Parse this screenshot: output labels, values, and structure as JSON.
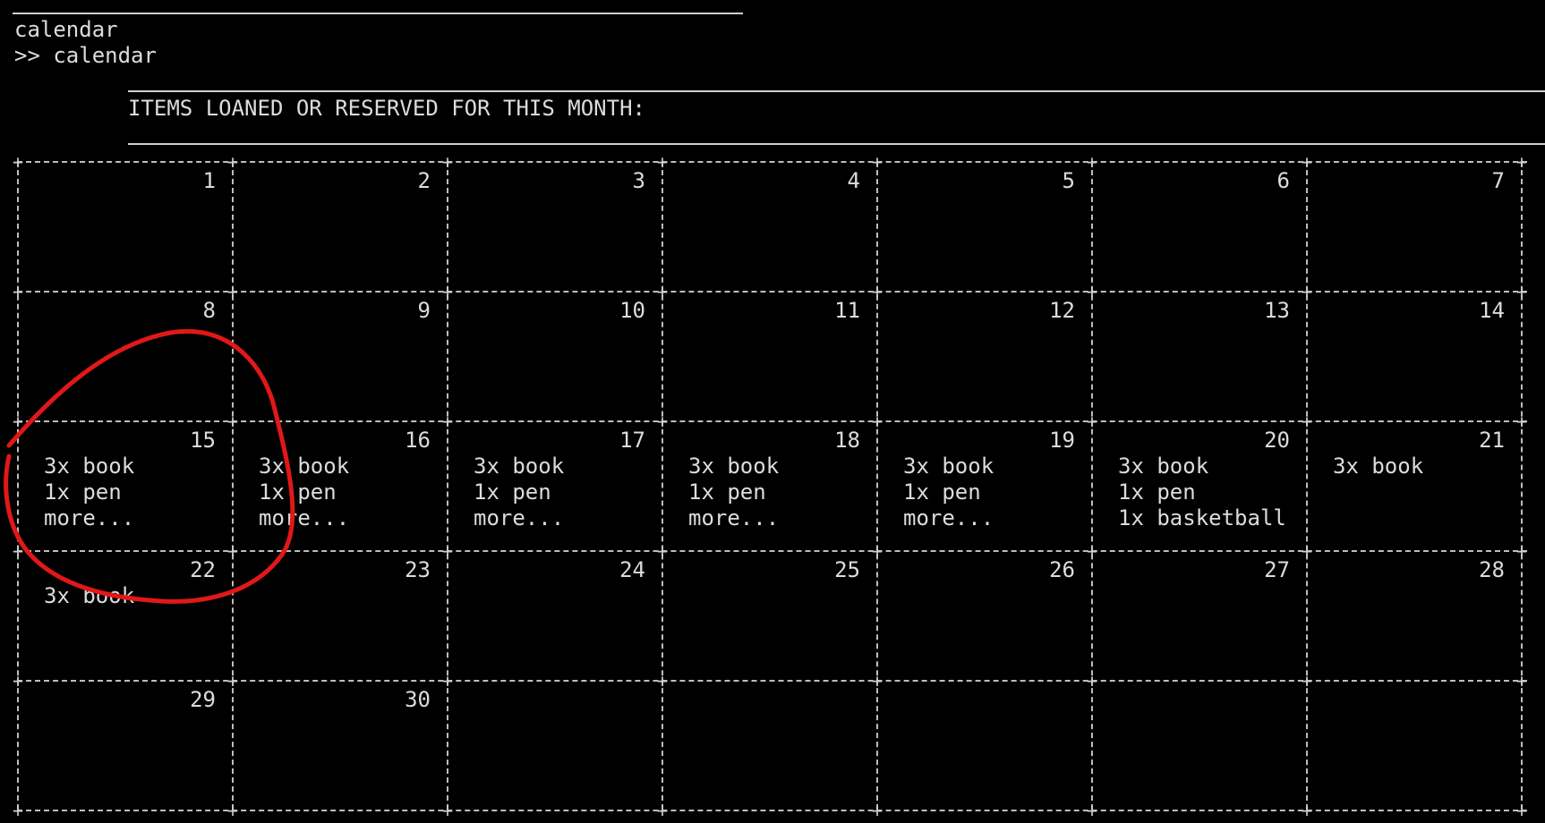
{
  "terminal": {
    "command_output": "calendar",
    "prompt": ">> calendar"
  },
  "header": {
    "title": "ITEMS LOANED OR RESERVED FOR THIS MONTH:"
  },
  "calendar": {
    "weeks": [
      [
        {
          "day": "1",
          "items": []
        },
        {
          "day": "2",
          "items": []
        },
        {
          "day": "3",
          "items": []
        },
        {
          "day": "4",
          "items": []
        },
        {
          "day": "5",
          "items": []
        },
        {
          "day": "6",
          "items": []
        },
        {
          "day": "7",
          "items": []
        }
      ],
      [
        {
          "day": "8",
          "items": []
        },
        {
          "day": "9",
          "items": []
        },
        {
          "day": "10",
          "items": []
        },
        {
          "day": "11",
          "items": []
        },
        {
          "day": "12",
          "items": []
        },
        {
          "day": "13",
          "items": []
        },
        {
          "day": "14",
          "items": []
        }
      ],
      [
        {
          "day": "15",
          "items": [
            "3x book",
            "1x pen",
            "more..."
          ]
        },
        {
          "day": "16",
          "items": [
            "3x book",
            "1x pen",
            "more..."
          ]
        },
        {
          "day": "17",
          "items": [
            "3x book",
            "1x pen",
            "more..."
          ]
        },
        {
          "day": "18",
          "items": [
            "3x book",
            "1x pen",
            "more..."
          ]
        },
        {
          "day": "19",
          "items": [
            "3x book",
            "1x pen",
            "more..."
          ]
        },
        {
          "day": "20",
          "items": [
            "3x book",
            "1x pen",
            "1x basketball"
          ]
        },
        {
          "day": "21",
          "items": [
            "3x book"
          ]
        }
      ],
      [
        {
          "day": "22",
          "items": [
            "3x book"
          ]
        },
        {
          "day": "23",
          "items": []
        },
        {
          "day": "24",
          "items": []
        },
        {
          "day": "25",
          "items": []
        },
        {
          "day": "26",
          "items": []
        },
        {
          "day": "27",
          "items": []
        },
        {
          "day": "28",
          "items": []
        }
      ],
      [
        {
          "day": "29",
          "items": []
        },
        {
          "day": "30",
          "items": []
        },
        {
          "day": "",
          "items": []
        },
        {
          "day": "",
          "items": []
        },
        {
          "day": "",
          "items": []
        },
        {
          "day": "",
          "items": []
        },
        {
          "day": "",
          "items": []
        }
      ]
    ]
  },
  "colors": {
    "background": "#000000",
    "text": "#dcdcdc",
    "annotation_circle": "#e01818"
  }
}
